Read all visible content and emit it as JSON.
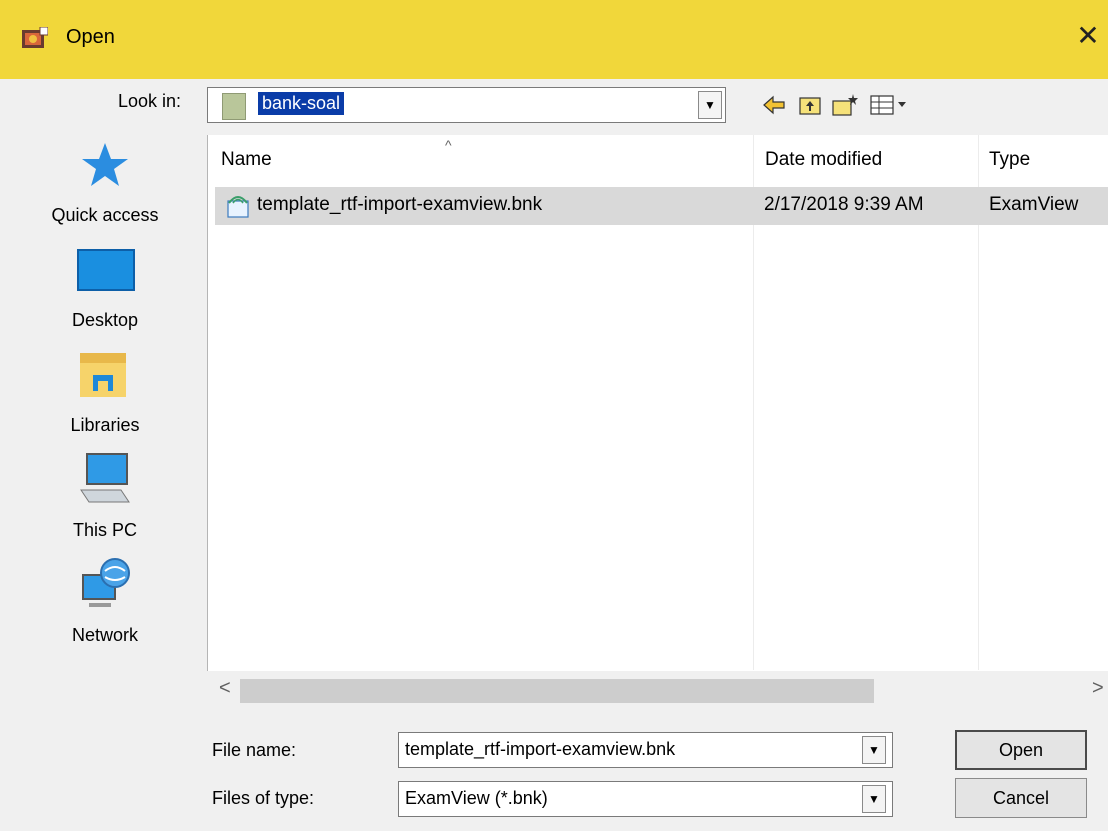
{
  "window": {
    "title": "Open",
    "close_glyph": "✕"
  },
  "look_in": {
    "label": "Look in:",
    "value": "bank-soal",
    "dropdown_glyph": "▼"
  },
  "toolbar": {
    "back_icon": "back-arrow-icon",
    "up_icon": "up-folder-icon",
    "new_folder_icon": "new-folder-icon",
    "views_icon": "view-menu-icon"
  },
  "places": [
    {
      "label": "Quick access",
      "icon": "star-icon"
    },
    {
      "label": "Desktop",
      "icon": "desktop-icon"
    },
    {
      "label": "Libraries",
      "icon": "libraries-icon"
    },
    {
      "label": "This PC",
      "icon": "computer-icon"
    },
    {
      "label": "Network",
      "icon": "network-icon"
    }
  ],
  "file_list": {
    "columns": [
      "Name",
      "Date modified",
      "Type"
    ],
    "sort_indicator": "^",
    "rows": [
      {
        "name": "template_rtf-import-examview.bnk",
        "date": "2/17/2018 9:39 AM",
        "type": "ExamView"
      }
    ],
    "scroll_left": "<",
    "scroll_right": ">"
  },
  "file_name": {
    "label": "File name:",
    "value": "template_rtf-import-examview.bnk"
  },
  "file_type": {
    "label": "Files of type:",
    "value": "ExamView (*.bnk)"
  },
  "buttons": {
    "open": "Open",
    "cancel": "Cancel"
  },
  "colors": {
    "titlebar": "#f1d73a",
    "selection": "#0a3ca8",
    "row_highlight": "#d9d9d9"
  }
}
